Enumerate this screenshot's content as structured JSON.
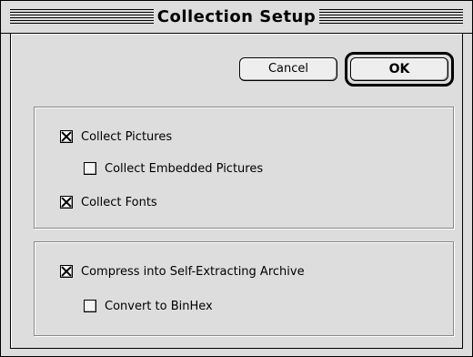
{
  "dialog": {
    "title": "Collection Setup"
  },
  "buttons": {
    "cancel_label": "Cancel",
    "ok_label": "OK"
  },
  "options": {
    "collect_pictures": {
      "label": "Collect Pictures",
      "checked": true
    },
    "collect_embedded_pictures": {
      "label": "Collect Embedded Pictures",
      "checked": false
    },
    "collect_fonts": {
      "label": "Collect Fonts",
      "checked": true
    },
    "compress_archive": {
      "label": "Compress into Self-Extracting Archive",
      "checked": true
    },
    "convert_binhex": {
      "label": "Convert to BinHex",
      "checked": false
    }
  },
  "colors": {
    "background": "#dddddd",
    "border": "#000000"
  }
}
